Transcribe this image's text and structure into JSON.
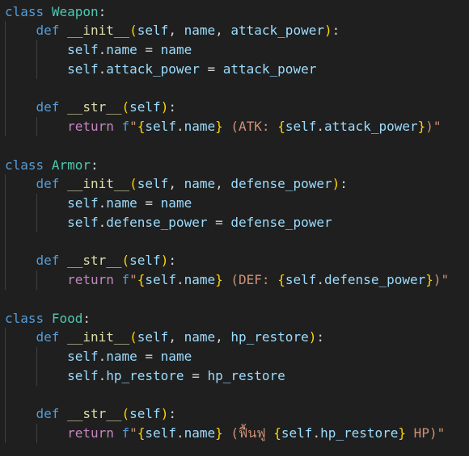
{
  "colors": {
    "background": "#1f1f1f",
    "keyword": "#569cd6",
    "control_keyword": "#c586c0",
    "class_name": "#4ec9b0",
    "function_name": "#dcdcaa",
    "variable": "#9cdcfe",
    "string": "#ce9178",
    "bracket_level_1": "#ffd700",
    "bracket_level_2": "#da70d6",
    "bracket_level_3": "#179fff",
    "indent_guide": "#404040"
  },
  "lines": [
    [
      [
        "kw",
        "class"
      ],
      [
        "op",
        " "
      ],
      [
        "cls",
        "Weapon"
      ],
      [
        "op",
        ":"
      ]
    ],
    [
      [
        "op",
        "    "
      ],
      [
        "kw",
        "def"
      ],
      [
        "op",
        " "
      ],
      [
        "fn",
        "__init__"
      ],
      [
        "p1",
        "("
      ],
      [
        "var",
        "self"
      ],
      [
        "op",
        ", "
      ],
      [
        "var",
        "name"
      ],
      [
        "op",
        ", "
      ],
      [
        "var",
        "attack_power"
      ],
      [
        "p1",
        ")"
      ],
      [
        "op",
        ":"
      ]
    ],
    [
      [
        "op",
        "        "
      ],
      [
        "var",
        "self"
      ],
      [
        "op",
        "."
      ],
      [
        "var",
        "name"
      ],
      [
        "op",
        " = "
      ],
      [
        "var",
        "name"
      ]
    ],
    [
      [
        "op",
        "        "
      ],
      [
        "var",
        "self"
      ],
      [
        "op",
        "."
      ],
      [
        "var",
        "attack_power"
      ],
      [
        "op",
        " = "
      ],
      [
        "var",
        "attack_power"
      ]
    ],
    [],
    [
      [
        "op",
        "    "
      ],
      [
        "kw",
        "def"
      ],
      [
        "op",
        " "
      ],
      [
        "fn",
        "__str__"
      ],
      [
        "p1",
        "("
      ],
      [
        "var",
        "self"
      ],
      [
        "p1",
        ")"
      ],
      [
        "op",
        ":"
      ]
    ],
    [
      [
        "op",
        "        "
      ],
      [
        "ctrl",
        "return"
      ],
      [
        "op",
        " "
      ],
      [
        "kw",
        "f"
      ],
      [
        "str",
        "\""
      ],
      [
        "p1",
        "{"
      ],
      [
        "var",
        "self"
      ],
      [
        "op",
        "."
      ],
      [
        "var",
        "name"
      ],
      [
        "p1",
        "}"
      ],
      [
        "str",
        " (ATK: "
      ],
      [
        "p1",
        "{"
      ],
      [
        "var",
        "self"
      ],
      [
        "op",
        "."
      ],
      [
        "var",
        "attack_power"
      ],
      [
        "p1",
        "}"
      ],
      [
        "str",
        ")\""
      ]
    ],
    [],
    [
      [
        "kw",
        "class"
      ],
      [
        "op",
        " "
      ],
      [
        "cls",
        "Armor"
      ],
      [
        "op",
        ":"
      ]
    ],
    [
      [
        "op",
        "    "
      ],
      [
        "kw",
        "def"
      ],
      [
        "op",
        " "
      ],
      [
        "fn",
        "__init__"
      ],
      [
        "p1",
        "("
      ],
      [
        "var",
        "self"
      ],
      [
        "op",
        ", "
      ],
      [
        "var",
        "name"
      ],
      [
        "op",
        ", "
      ],
      [
        "var",
        "defense_power"
      ],
      [
        "p1",
        ")"
      ],
      [
        "op",
        ":"
      ]
    ],
    [
      [
        "op",
        "        "
      ],
      [
        "var",
        "self"
      ],
      [
        "op",
        "."
      ],
      [
        "var",
        "name"
      ],
      [
        "op",
        " = "
      ],
      [
        "var",
        "name"
      ]
    ],
    [
      [
        "op",
        "        "
      ],
      [
        "var",
        "self"
      ],
      [
        "op",
        "."
      ],
      [
        "var",
        "defense_power"
      ],
      [
        "op",
        " = "
      ],
      [
        "var",
        "defense_power"
      ]
    ],
    [],
    [
      [
        "op",
        "    "
      ],
      [
        "kw",
        "def"
      ],
      [
        "op",
        " "
      ],
      [
        "fn",
        "__str__"
      ],
      [
        "p1",
        "("
      ],
      [
        "var",
        "self"
      ],
      [
        "p1",
        ")"
      ],
      [
        "op",
        ":"
      ]
    ],
    [
      [
        "op",
        "        "
      ],
      [
        "ctrl",
        "return"
      ],
      [
        "op",
        " "
      ],
      [
        "kw",
        "f"
      ],
      [
        "str",
        "\""
      ],
      [
        "p1",
        "{"
      ],
      [
        "var",
        "self"
      ],
      [
        "op",
        "."
      ],
      [
        "var",
        "name"
      ],
      [
        "p1",
        "}"
      ],
      [
        "str",
        " (DEF: "
      ],
      [
        "p1",
        "{"
      ],
      [
        "var",
        "self"
      ],
      [
        "op",
        "."
      ],
      [
        "var",
        "defense_power"
      ],
      [
        "p1",
        "}"
      ],
      [
        "str",
        ")\""
      ]
    ],
    [],
    [
      [
        "kw",
        "class"
      ],
      [
        "op",
        " "
      ],
      [
        "cls",
        "Food"
      ],
      [
        "op",
        ":"
      ]
    ],
    [
      [
        "op",
        "    "
      ],
      [
        "kw",
        "def"
      ],
      [
        "op",
        " "
      ],
      [
        "fn",
        "__init__"
      ],
      [
        "p1",
        "("
      ],
      [
        "var",
        "self"
      ],
      [
        "op",
        ", "
      ],
      [
        "var",
        "name"
      ],
      [
        "op",
        ", "
      ],
      [
        "var",
        "hp_restore"
      ],
      [
        "p1",
        ")"
      ],
      [
        "op",
        ":"
      ]
    ],
    [
      [
        "op",
        "        "
      ],
      [
        "var",
        "self"
      ],
      [
        "op",
        "."
      ],
      [
        "var",
        "name"
      ],
      [
        "op",
        " = "
      ],
      [
        "var",
        "name"
      ]
    ],
    [
      [
        "op",
        "        "
      ],
      [
        "var",
        "self"
      ],
      [
        "op",
        "."
      ],
      [
        "var",
        "hp_restore"
      ],
      [
        "op",
        " = "
      ],
      [
        "var",
        "hp_restore"
      ]
    ],
    [],
    [
      [
        "op",
        "    "
      ],
      [
        "kw",
        "def"
      ],
      [
        "op",
        " "
      ],
      [
        "fn",
        "__str__"
      ],
      [
        "p1",
        "("
      ],
      [
        "var",
        "self"
      ],
      [
        "p1",
        ")"
      ],
      [
        "op",
        ":"
      ]
    ],
    [
      [
        "op",
        "        "
      ],
      [
        "ctrl",
        "return"
      ],
      [
        "op",
        " "
      ],
      [
        "kw",
        "f"
      ],
      [
        "str",
        "\""
      ],
      [
        "p1",
        "{"
      ],
      [
        "var",
        "self"
      ],
      [
        "op",
        "."
      ],
      [
        "var",
        "name"
      ],
      [
        "p1",
        "}"
      ],
      [
        "str",
        " (ฟื้นฟู "
      ],
      [
        "p1",
        "{"
      ],
      [
        "var",
        "self"
      ],
      [
        "op",
        "."
      ],
      [
        "var",
        "hp_restore"
      ],
      [
        "p1",
        "}"
      ],
      [
        "str",
        " HP)\""
      ]
    ]
  ]
}
